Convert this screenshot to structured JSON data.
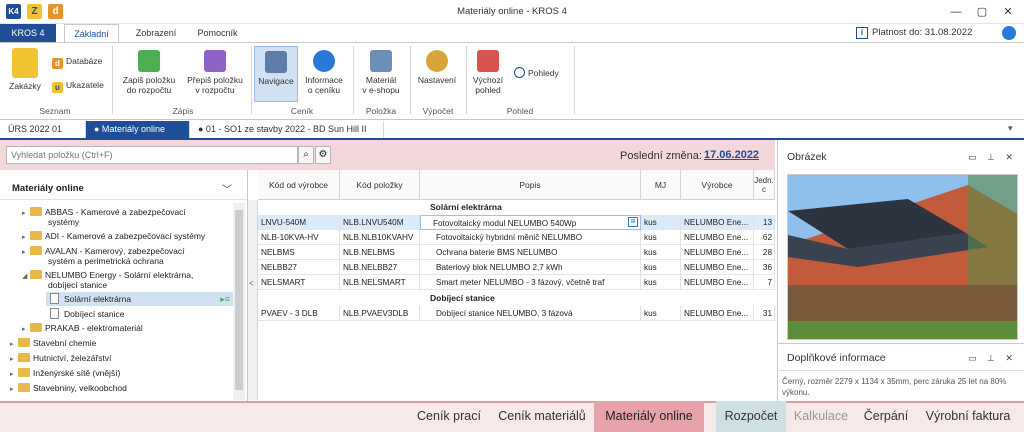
{
  "window": {
    "title": "Materiály online - KROS 4",
    "quick_access": [
      {
        "label": "K4",
        "icon": "kros-logo-icon"
      },
      {
        "label": "Z",
        "icon": "z-icon"
      },
      {
        "label": "d",
        "icon": "d-icon"
      }
    ],
    "controls": {
      "minimize": "—",
      "restore": "▢",
      "close": "✕"
    }
  },
  "ribbon_tabs": [
    "KROS 4",
    "Základní",
    "Zobrazení",
    "Pomocník"
  ],
  "validity": {
    "label": "Platnost do: 31.08.2022",
    "info_icon": "i"
  },
  "ribbon": {
    "groups": {
      "seznam": "Seznam",
      "zapis": "Zápis",
      "cenik": "Ceník",
      "polozka": "Položka",
      "vypocet": "Výpočet",
      "pohled": "Pohled"
    },
    "buttons": {
      "zakazky": "Zakázky",
      "databaze": "Databáze",
      "ukazatele": "Ukazatele",
      "zapis_l1": "Zapiš položku",
      "zapis_l2": "do rozpočtu",
      "prepis_l1": "Přepiš položku",
      "prepis_l2": "v rozpočtu",
      "navigace": "Navigace",
      "info_l1": "Informace",
      "info_l2": "o ceníku",
      "material_l1": "Materiál",
      "material_l2": "v e-shopu",
      "nastaveni": "Nastavení",
      "vychozi_l1": "Výchozí",
      "vychozi_l2": "pohled",
      "pohledy": "Pohledy"
    }
  },
  "doc_tabs": [
    {
      "label": "ÚRS 2022 01"
    },
    {
      "label": "● Materiály online",
      "close": "✕"
    },
    {
      "label": "● 01 - SO1 ze stavby 2022 - BD Sun Hill II"
    }
  ],
  "doc_tabs_dropdown": "▾",
  "search": {
    "placeholder": "Vyhledat položku (Ctrl+F)",
    "search_icon": "⌕",
    "settings_icon": "⚙"
  },
  "last_change": {
    "label": "Poslední změna:",
    "date": "17.06.2022"
  },
  "tree": {
    "title": "Materiály online",
    "collapse_icon": "﹀",
    "items": [
      {
        "label_1": "ABBAS - Kamerové a zabezpečovací",
        "label_2": "systémy"
      },
      {
        "label_1": "ADI - Kamerové a zabezpečovací systémy"
      },
      {
        "label_1": "AVALAN - Kamerový, zabezpečovací",
        "label_2": "systém a perimetrická ochrana"
      },
      {
        "label_1": "NELUMBO Energy - Solární elektrárna,",
        "label_2": "dobíjecí stanice"
      },
      {
        "label_1": "Solární elektrárna"
      },
      {
        "label_1": "Dobíjecí stanice"
      },
      {
        "label_1": "PRAKAB - elektromateriál"
      },
      {
        "label_1": "Stavební chemie"
      },
      {
        "label_1": "Hutnictví, železářství"
      },
      {
        "label_1": "Inženýrské sítě (vnější)"
      },
      {
        "label_1": "Stavebniny, velkoobchod"
      }
    ]
  },
  "table": {
    "columns": [
      "Kód od výrobce",
      "Kód položky",
      "Popis",
      "MJ",
      "Výrobce",
      "Jedn. c"
    ],
    "groups": [
      "Solární elektrárna",
      "Dobíjecí stanice"
    ],
    "rows": [
      {
        "kod_vyrobce": "LNVU-540M",
        "kod_polozky": "NLB.LNVU540M",
        "popis": "Fotovoltaický modul NELUMBO 540Wp",
        "mj": "kus",
        "vyrobce": "NELUMBO Ene...",
        "cena": "13"
      },
      {
        "kod_vyrobce": "NLB-10KVA-HV",
        "kod_polozky": "NLB.NLB10KVAHV",
        "popis": "Fotovoltaický hybridní měnič NELUMBO",
        "mj": "kus",
        "vyrobce": "NELUMBO Ene...",
        "cena": "62"
      },
      {
        "kod_vyrobce": "NELBMS",
        "kod_polozky": "NLB.NELBMS",
        "popis": "Ochrana baterie BMS NELUMBO",
        "mj": "kus",
        "vyrobce": "NELUMBO Ene...",
        "cena": "28"
      },
      {
        "kod_vyrobce": "NELBB27",
        "kod_polozky": "NLB.NELBB27",
        "popis": "Bateriový blok NELUMBO 2,7 kWh",
        "mj": "kus",
        "vyrobce": "NELUMBO Ene...",
        "cena": "36"
      },
      {
        "kod_vyrobce": "NELSMART",
        "kod_polozky": "NLB.NELSMART",
        "popis": "Smart meter NELUMBO - 3 fázový, včetně traf",
        "mj": "kus",
        "vyrobce": "NELUMBO Ene...",
        "cena": "7"
      },
      {
        "kod_vyrobce": "PVAEV - 3 DLB",
        "kod_polozky": "NLB.PVAEV3DLB",
        "popis": "Dobíjecí stanice NELUMBO, 3 fázová",
        "mj": "kus",
        "vyrobce": "NELUMBO Ene...",
        "cena": "31"
      }
    ],
    "splitter_arrow": "<"
  },
  "panels": {
    "obrazek": {
      "title": "Obrázek",
      "buttons": "▭ ⊥ ✕"
    },
    "doplnkove": {
      "title": "Doplňkové informace",
      "buttons": "▭ ⊥ ✕",
      "text": "Černý, rozměr 2279 x 1134 x 35mm, perc záruka 25 let na 80% výkonu."
    }
  },
  "bottom_nav": [
    "Ceník prací",
    "Ceník materiálů",
    "Materiály online",
    "Rozpočet",
    "Kalkulace",
    "Čerpání",
    "Výrobní faktura"
  ],
  "colors": {
    "brand": "#1f4e96",
    "active_nav": "#e7a3a9",
    "toolbar_pink": "#f4d7da"
  }
}
